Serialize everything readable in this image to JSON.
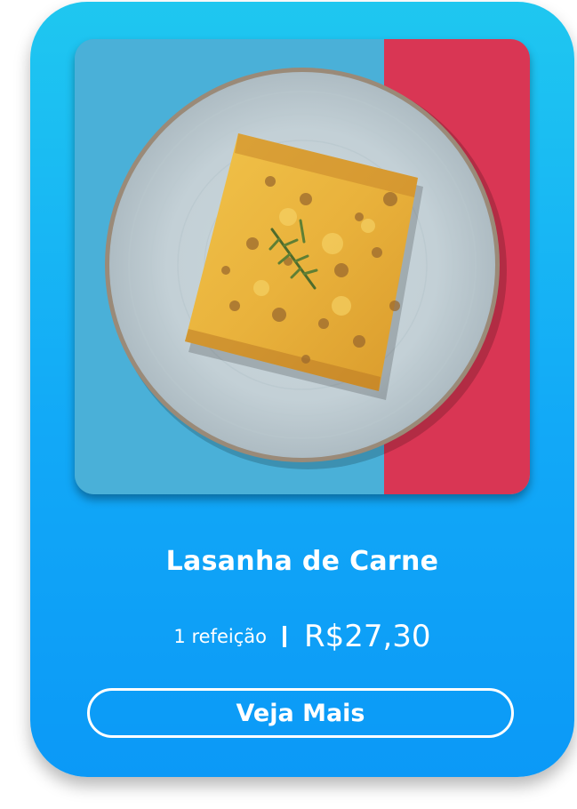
{
  "product": {
    "name": "Lasanha de Carne",
    "portion": "1 refeição",
    "price": "R$27,30",
    "cta_label": "Veja Mais",
    "image_alt": "Lasanha de Carne"
  },
  "colors": {
    "card_top": "#1fc7f0",
    "card_bottom": "#0b99f7",
    "photo_bg_blue": "#4ab0d8",
    "photo_bg_red": "#d93654",
    "text": "#ffffff"
  }
}
